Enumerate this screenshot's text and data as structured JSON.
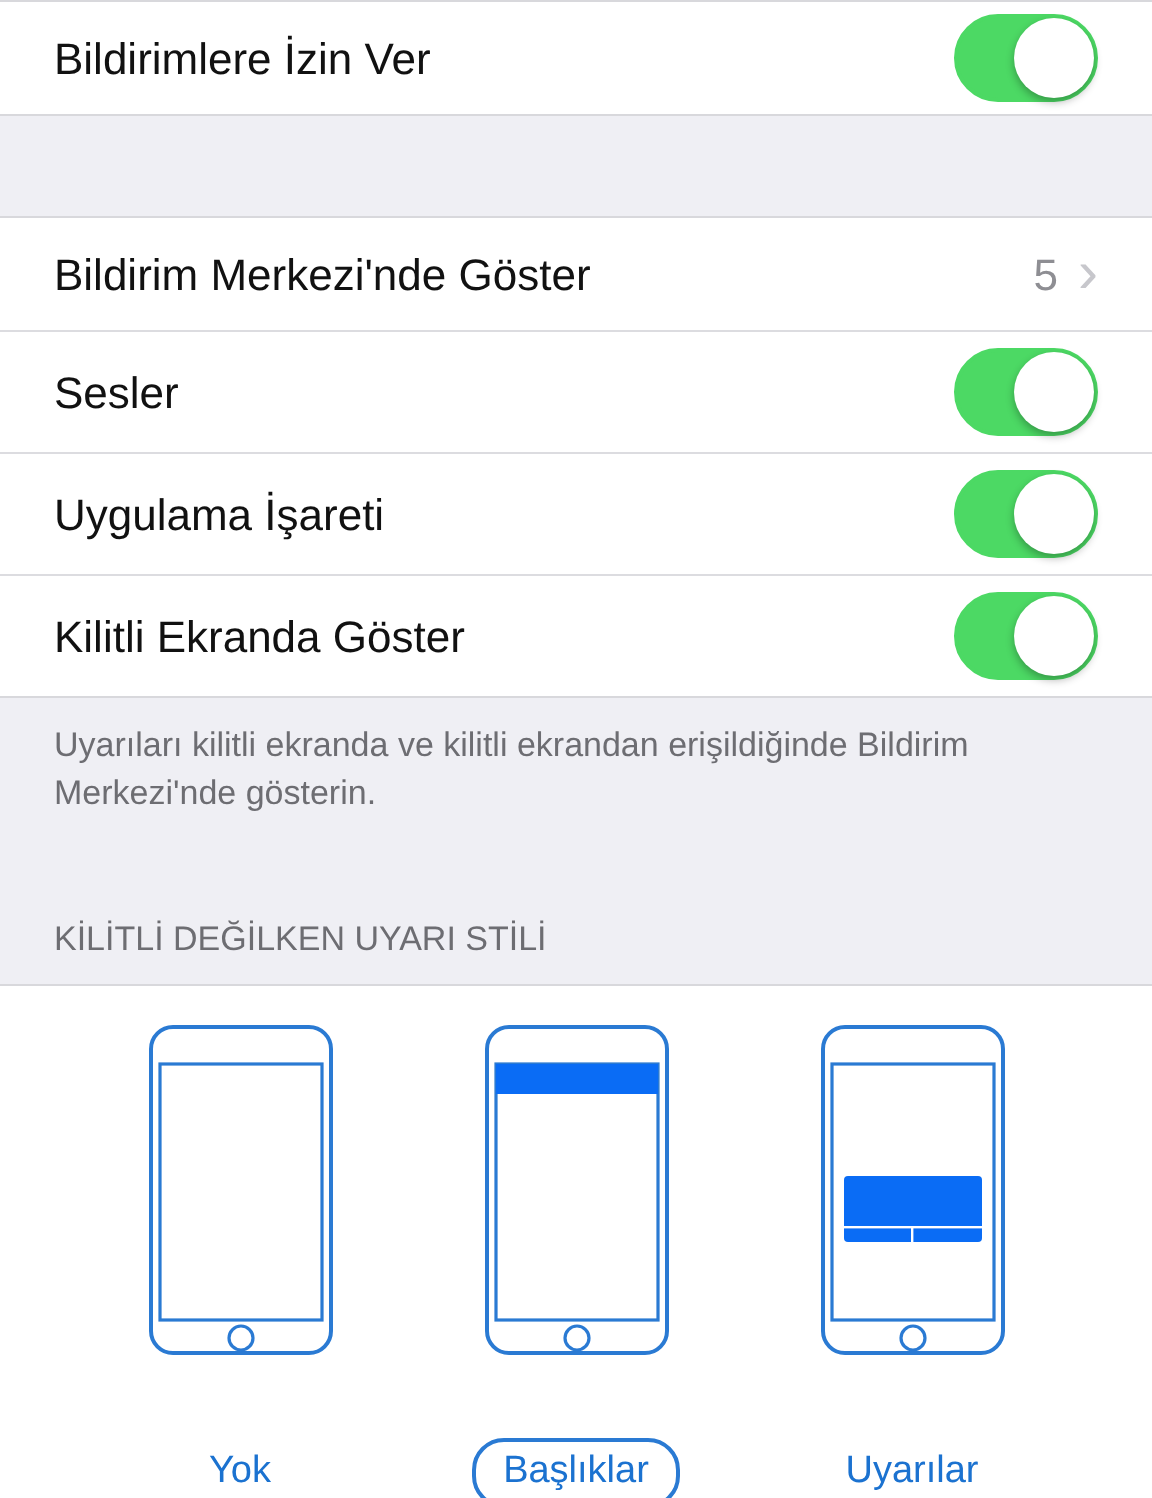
{
  "top_group": [
    {
      "kind": "toggle",
      "label": "Bildirimlere İzin Ver",
      "on": true
    }
  ],
  "main_group": [
    {
      "kind": "detail",
      "label": "Bildirim Merkezi'nde Göster",
      "value": "5",
      "chevron": "›"
    },
    {
      "kind": "toggle",
      "label": "Sesler",
      "on": true
    },
    {
      "kind": "toggle",
      "label": "Uygulama İşareti",
      "on": true
    },
    {
      "kind": "toggle",
      "label": "Kilitli Ekranda Göster",
      "on": true
    }
  ],
  "footer_note": "Uyarıları kilitli ekranda ve kilitli ekrandan erişildiğinde Bildirim Merkezi'nde gösterin.",
  "section_header": "KİLİTLİ DEĞİLKEN UYARI STİLİ",
  "alert_styles": [
    {
      "kind": "none",
      "label": "Yok",
      "selected": false
    },
    {
      "kind": "banner",
      "label": "Başlıklar",
      "selected": true
    },
    {
      "kind": "alert",
      "label": "Uyarılar",
      "selected": false
    }
  ]
}
